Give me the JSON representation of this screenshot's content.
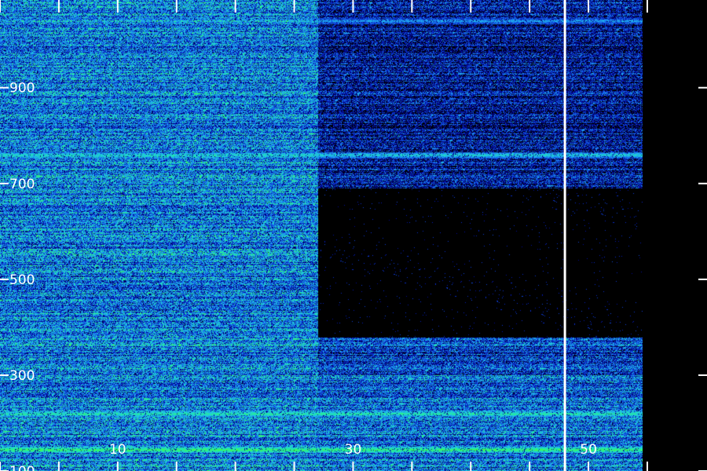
{
  "chart_data": {
    "type": "heatmap",
    "title": "",
    "xlabel": "",
    "ylabel": "",
    "xlim": [
      0,
      54.6
    ],
    "ylim": [
      100,
      1083
    ],
    "x_ticks": [
      0,
      5,
      10,
      15,
      20,
      25,
      30,
      35,
      40,
      45,
      50,
      55
    ],
    "x_tick_labels": [
      {
        "value": 10,
        "label": "10"
      },
      {
        "value": 30,
        "label": "30"
      },
      {
        "value": 50,
        "label": "50"
      }
    ],
    "y_ticks": [
      100,
      300,
      500,
      700,
      900
    ],
    "y_tick_labels": [
      {
        "value": 900,
        "label": "900"
      },
      {
        "value": 700,
        "label": "700"
      },
      {
        "value": 500,
        "label": "500"
      },
      {
        "value": 300,
        "label": "300"
      },
      {
        "value": 100,
        "label": "100"
      }
    ],
    "colormap": [
      "#000000",
      "#00008b",
      "#0a30d0",
      "#1a78f0",
      "#20c0e8",
      "#20e8b0",
      "#40ff40"
    ],
    "regions": [
      {
        "name": "broadband",
        "x": [
          0,
          27
        ],
        "y": [
          100,
          1083
        ],
        "level": 0.55
      },
      {
        "name": "quiet",
        "x": [
          27,
          54.6
        ],
        "y": [
          380,
          690
        ],
        "level": 0.0
      },
      {
        "name": "sparse-noise",
        "x": [
          27,
          54.6
        ],
        "y": [
          690,
          1083
        ],
        "level": 0.25
      },
      {
        "name": "lower-noise",
        "x": [
          27,
          54.6
        ],
        "y": [
          100,
          300
        ],
        "level": 0.5
      }
    ],
    "emission_lines": [
      {
        "y": 145,
        "level": 0.95
      },
      {
        "y": 220,
        "level": 0.85
      },
      {
        "y": 760,
        "level": 0.75
      },
      {
        "y": 1040,
        "level": 0.6
      }
    ],
    "marker_line_x": 48,
    "grid": false
  }
}
